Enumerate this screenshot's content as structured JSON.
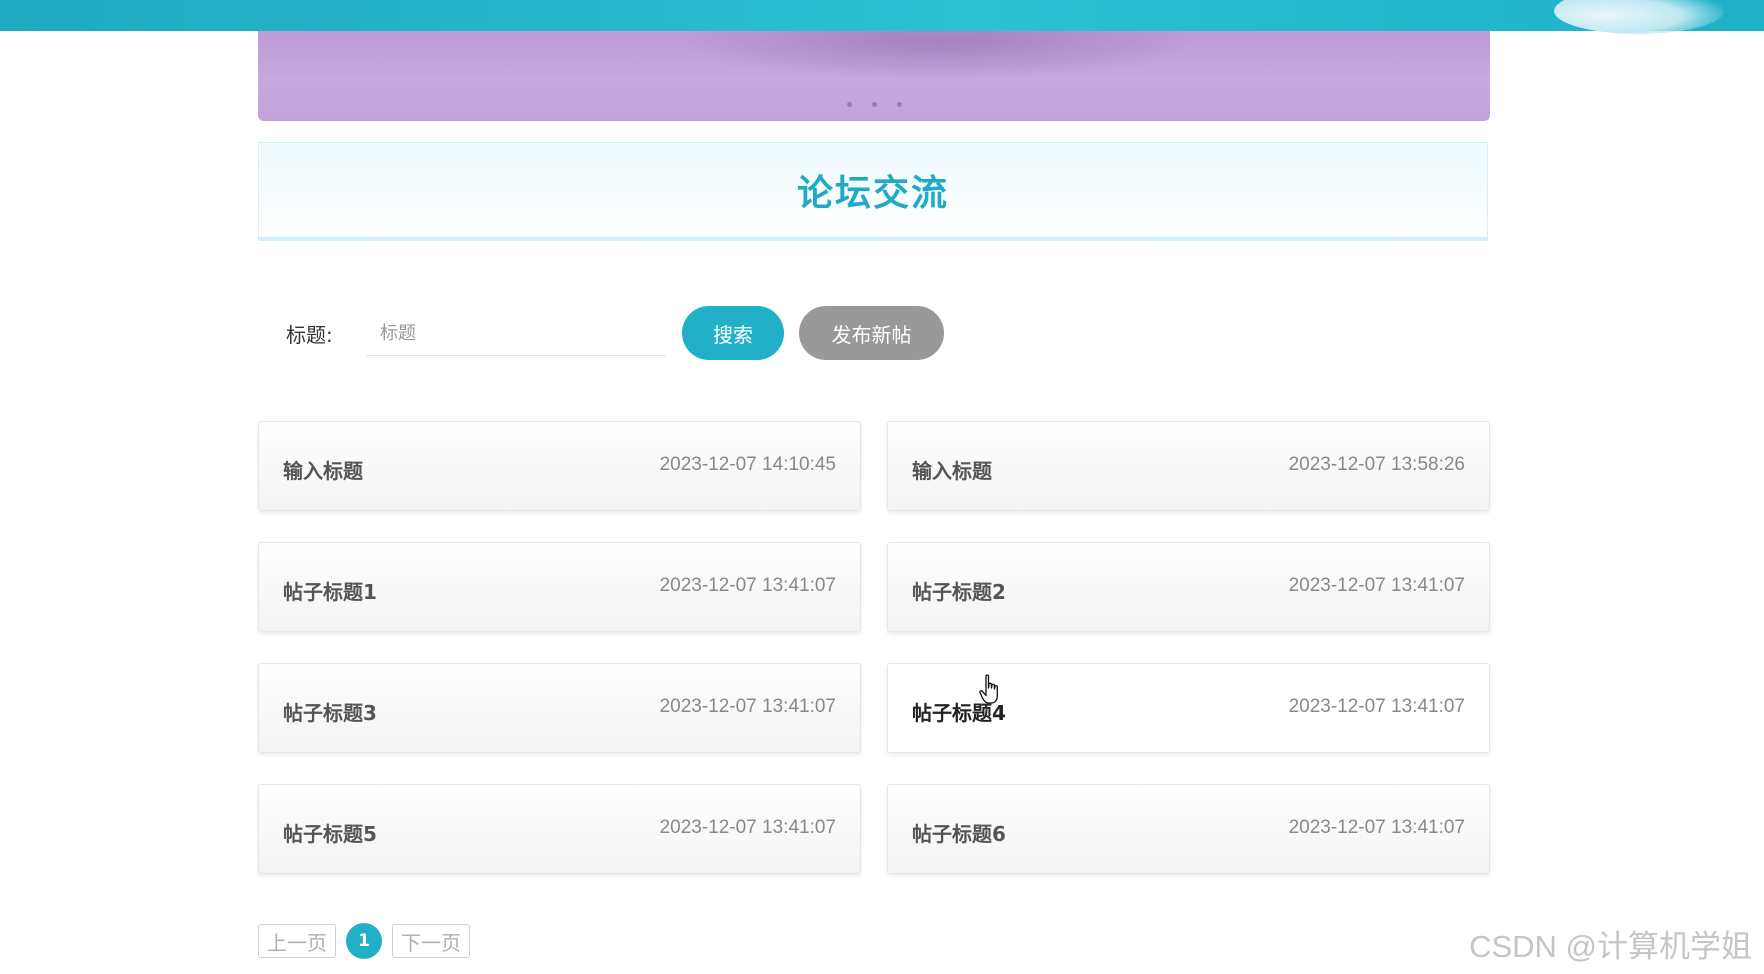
{
  "section": {
    "title": "论坛交流"
  },
  "search": {
    "label": "标题:",
    "placeholder": "标题",
    "value": "",
    "search_label": "搜索",
    "new_post_label": "发布新帖"
  },
  "posts": [
    {
      "title": "输入标题",
      "time": "2023-12-07 14:10:45"
    },
    {
      "title": "输入标题",
      "time": "2023-12-07 13:58:26"
    },
    {
      "title": "帖子标题1",
      "time": "2023-12-07 13:41:07"
    },
    {
      "title": "帖子标题2",
      "time": "2023-12-07 13:41:07"
    },
    {
      "title": "帖子标题3",
      "time": "2023-12-07 13:41:07"
    },
    {
      "title": "帖子标题4",
      "time": "2023-12-07 13:41:07"
    },
    {
      "title": "帖子标题5",
      "time": "2023-12-07 13:41:07"
    },
    {
      "title": "帖子标题6",
      "time": "2023-12-07 13:41:07"
    }
  ],
  "pagination": {
    "prev_label": "上一页",
    "current_page": "1",
    "next_label": "下一页"
  },
  "watermark": "CSDN @计算机学姐",
  "colors": {
    "accent": "#22b0c8",
    "secondary_button": "#999999",
    "banner": "#c8a8dd"
  }
}
